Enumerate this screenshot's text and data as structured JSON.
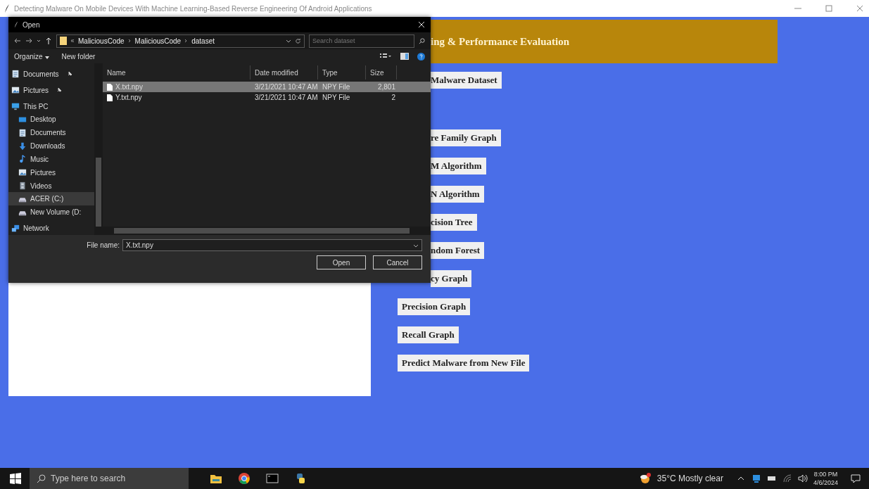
{
  "window": {
    "title": "Detecting Malware On Mobile Devices With Machine Learning-Based Reverse Engineering Of Android Applications"
  },
  "app": {
    "header": "ing & Performance Evaluation",
    "buttons": [
      {
        "label": "Malware Dataset",
        "covered": true
      },
      {
        "label": "re Family Graph",
        "covered": true
      },
      {
        "label": "M Algorithm",
        "covered": true
      },
      {
        "label": "N Algorithm",
        "covered": true
      },
      {
        "label": "cision Tree",
        "covered": true
      },
      {
        "label": "ndom Forest",
        "covered": true
      },
      {
        "label": "cy Graph",
        "covered": true
      },
      {
        "label": "Precision Graph",
        "covered": false
      },
      {
        "label": "Recall Graph",
        "covered": false
      },
      {
        "label": "Predict Malware from New File",
        "covered": false
      }
    ]
  },
  "dialog": {
    "title": "Open",
    "path": [
      "MaliciousCode",
      "MaliciousCode",
      "dataset"
    ],
    "search": {
      "placeholder": "Search dataset"
    },
    "toolbar": [
      "Organize",
      "New folder"
    ],
    "nav": [
      {
        "label": "Documents",
        "kind": "documents",
        "pinned": true,
        "selected": false
      },
      {
        "label": "Pictures",
        "kind": "pictures",
        "pinned": true,
        "selected": false
      },
      {
        "label": "This PC",
        "kind": "pc",
        "pinned": false,
        "selected": false,
        "children": [
          {
            "label": "Desktop",
            "kind": "desktop",
            "pinned": false,
            "selected": false
          },
          {
            "label": "Documents",
            "kind": "documents",
            "pinned": false,
            "selected": false
          },
          {
            "label": "Downloads",
            "kind": "downloads",
            "pinned": false,
            "selected": false
          },
          {
            "label": "Music",
            "kind": "music",
            "pinned": false,
            "selected": false
          },
          {
            "label": "Pictures",
            "kind": "pictures",
            "pinned": false,
            "selected": false
          },
          {
            "label": "Videos",
            "kind": "videos",
            "pinned": false,
            "selected": false
          },
          {
            "label": "ACER (C:)",
            "kind": "drive",
            "pinned": false,
            "selected": true
          },
          {
            "label": "New Volume (D:",
            "kind": "drive",
            "pinned": false,
            "selected": false
          }
        ]
      },
      {
        "label": "Network",
        "kind": "network",
        "pinned": false,
        "selected": false
      }
    ],
    "columns": [
      "Name",
      "Date modified",
      "Type",
      "Size"
    ],
    "files": [
      {
        "name": "X.txt.npy",
        "date": "3/21/2021 10:47 AM",
        "type": "NPY File",
        "size": "2,801",
        "selected": true
      },
      {
        "name": "Y.txt.npy",
        "date": "3/21/2021 10:47 AM",
        "type": "NPY File",
        "size": "2",
        "selected": false
      }
    ],
    "filename_label": "File name:",
    "filename": "X.txt.npy",
    "buttons": [
      "Open",
      "Cancel"
    ]
  },
  "taskbar": {
    "search": {
      "placeholder": "Type here to search"
    },
    "weather": "35°C  Mostly clear",
    "time": "8:00 PM",
    "date": "4/6/2024"
  }
}
